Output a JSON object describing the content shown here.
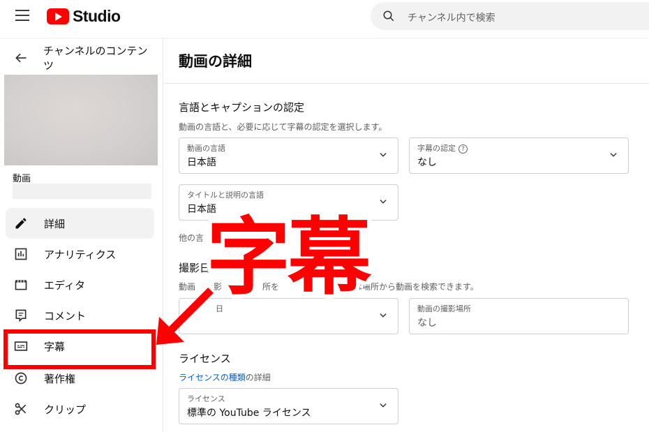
{
  "header": {
    "logo_text": "Studio",
    "search_placeholder": "チャンネル内で検索"
  },
  "sidebar": {
    "back_title": "チャンネルのコンテンツ",
    "video_label": "動画",
    "items": [
      {
        "label": "詳細",
        "icon": "pencil-icon",
        "active": true
      },
      {
        "label": "アナリティクス",
        "icon": "analytics-icon"
      },
      {
        "label": "エディタ",
        "icon": "editor-icon"
      },
      {
        "label": "コメント",
        "icon": "comment-icon"
      },
      {
        "label": "字幕",
        "icon": "subtitles-icon"
      },
      {
        "label": "著作権",
        "icon": "copyright-icon"
      },
      {
        "label": "クリップ",
        "icon": "scissors-icon"
      }
    ]
  },
  "main": {
    "title": "動画の詳細",
    "language_section": {
      "title": "言語とキャプションの認定",
      "description": "動画の言語と、必要に応じて字幕の認定を選択します。",
      "video_language": {
        "label": "動画の言語",
        "value": "日本語"
      },
      "caption_cert": {
        "label": "字幕の認定",
        "value": "なし"
      },
      "title_language": {
        "label": "タイトルと説明の言語",
        "value": "日本語"
      },
      "other_languages_partial": "他の言"
    },
    "recording_section": {
      "title_partial": "撮影日",
      "description_partial_left": "動画",
      "description_partial_mid": "影",
      "description_partial_mid2": "所を",
      "description_partial_right": "は場所から動画を検索できます。",
      "date_label_partial": "日",
      "location": {
        "label": "動画の撮影場所",
        "value": "なし"
      }
    },
    "license_section": {
      "title": "ライセンス",
      "link_text": "ライセンスの種類",
      "link_suffix": "の詳細",
      "license": {
        "label": "ライセンス",
        "value": "標準の YouTube ライセンス"
      }
    }
  },
  "annotation": {
    "overlay_text": "字幕",
    "color": "#ff0000"
  }
}
